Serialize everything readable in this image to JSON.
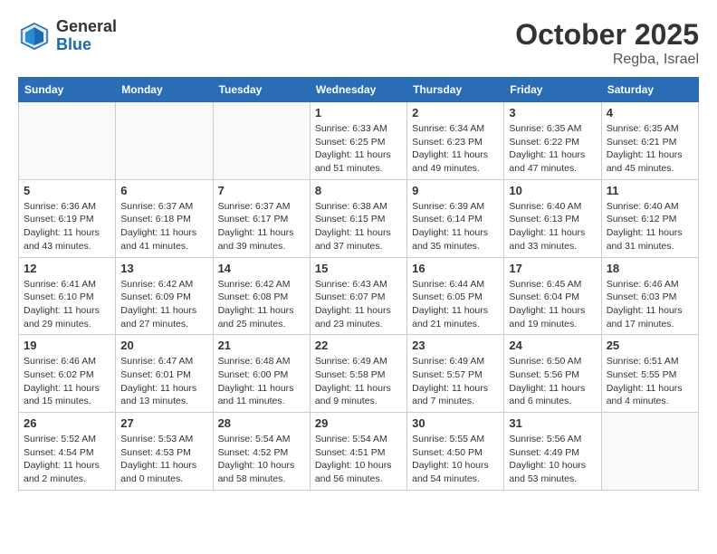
{
  "logo": {
    "general": "General",
    "blue": "Blue"
  },
  "title": "October 2025",
  "location": "Regba, Israel",
  "weekdays": [
    "Sunday",
    "Monday",
    "Tuesday",
    "Wednesday",
    "Thursday",
    "Friday",
    "Saturday"
  ],
  "weeks": [
    [
      {
        "day": "",
        "info": ""
      },
      {
        "day": "",
        "info": ""
      },
      {
        "day": "",
        "info": ""
      },
      {
        "day": "1",
        "info": "Sunrise: 6:33 AM\nSunset: 6:25 PM\nDaylight: 11 hours\nand 51 minutes."
      },
      {
        "day": "2",
        "info": "Sunrise: 6:34 AM\nSunset: 6:23 PM\nDaylight: 11 hours\nand 49 minutes."
      },
      {
        "day": "3",
        "info": "Sunrise: 6:35 AM\nSunset: 6:22 PM\nDaylight: 11 hours\nand 47 minutes."
      },
      {
        "day": "4",
        "info": "Sunrise: 6:35 AM\nSunset: 6:21 PM\nDaylight: 11 hours\nand 45 minutes."
      }
    ],
    [
      {
        "day": "5",
        "info": "Sunrise: 6:36 AM\nSunset: 6:19 PM\nDaylight: 11 hours\nand 43 minutes."
      },
      {
        "day": "6",
        "info": "Sunrise: 6:37 AM\nSunset: 6:18 PM\nDaylight: 11 hours\nand 41 minutes."
      },
      {
        "day": "7",
        "info": "Sunrise: 6:37 AM\nSunset: 6:17 PM\nDaylight: 11 hours\nand 39 minutes."
      },
      {
        "day": "8",
        "info": "Sunrise: 6:38 AM\nSunset: 6:15 PM\nDaylight: 11 hours\nand 37 minutes."
      },
      {
        "day": "9",
        "info": "Sunrise: 6:39 AM\nSunset: 6:14 PM\nDaylight: 11 hours\nand 35 minutes."
      },
      {
        "day": "10",
        "info": "Sunrise: 6:40 AM\nSunset: 6:13 PM\nDaylight: 11 hours\nand 33 minutes."
      },
      {
        "day": "11",
        "info": "Sunrise: 6:40 AM\nSunset: 6:12 PM\nDaylight: 11 hours\nand 31 minutes."
      }
    ],
    [
      {
        "day": "12",
        "info": "Sunrise: 6:41 AM\nSunset: 6:10 PM\nDaylight: 11 hours\nand 29 minutes."
      },
      {
        "day": "13",
        "info": "Sunrise: 6:42 AM\nSunset: 6:09 PM\nDaylight: 11 hours\nand 27 minutes."
      },
      {
        "day": "14",
        "info": "Sunrise: 6:42 AM\nSunset: 6:08 PM\nDaylight: 11 hours\nand 25 minutes."
      },
      {
        "day": "15",
        "info": "Sunrise: 6:43 AM\nSunset: 6:07 PM\nDaylight: 11 hours\nand 23 minutes."
      },
      {
        "day": "16",
        "info": "Sunrise: 6:44 AM\nSunset: 6:05 PM\nDaylight: 11 hours\nand 21 minutes."
      },
      {
        "day": "17",
        "info": "Sunrise: 6:45 AM\nSunset: 6:04 PM\nDaylight: 11 hours\nand 19 minutes."
      },
      {
        "day": "18",
        "info": "Sunrise: 6:46 AM\nSunset: 6:03 PM\nDaylight: 11 hours\nand 17 minutes."
      }
    ],
    [
      {
        "day": "19",
        "info": "Sunrise: 6:46 AM\nSunset: 6:02 PM\nDaylight: 11 hours\nand 15 minutes."
      },
      {
        "day": "20",
        "info": "Sunrise: 6:47 AM\nSunset: 6:01 PM\nDaylight: 11 hours\nand 13 minutes."
      },
      {
        "day": "21",
        "info": "Sunrise: 6:48 AM\nSunset: 6:00 PM\nDaylight: 11 hours\nand 11 minutes."
      },
      {
        "day": "22",
        "info": "Sunrise: 6:49 AM\nSunset: 5:58 PM\nDaylight: 11 hours\nand 9 minutes."
      },
      {
        "day": "23",
        "info": "Sunrise: 6:49 AM\nSunset: 5:57 PM\nDaylight: 11 hours\nand 7 minutes."
      },
      {
        "day": "24",
        "info": "Sunrise: 6:50 AM\nSunset: 5:56 PM\nDaylight: 11 hours\nand 6 minutes."
      },
      {
        "day": "25",
        "info": "Sunrise: 6:51 AM\nSunset: 5:55 PM\nDaylight: 11 hours\nand 4 minutes."
      }
    ],
    [
      {
        "day": "26",
        "info": "Sunrise: 5:52 AM\nSunset: 4:54 PM\nDaylight: 11 hours\nand 2 minutes."
      },
      {
        "day": "27",
        "info": "Sunrise: 5:53 AM\nSunset: 4:53 PM\nDaylight: 11 hours\nand 0 minutes."
      },
      {
        "day": "28",
        "info": "Sunrise: 5:54 AM\nSunset: 4:52 PM\nDaylight: 10 hours\nand 58 minutes."
      },
      {
        "day": "29",
        "info": "Sunrise: 5:54 AM\nSunset: 4:51 PM\nDaylight: 10 hours\nand 56 minutes."
      },
      {
        "day": "30",
        "info": "Sunrise: 5:55 AM\nSunset: 4:50 PM\nDaylight: 10 hours\nand 54 minutes."
      },
      {
        "day": "31",
        "info": "Sunrise: 5:56 AM\nSunset: 4:49 PM\nDaylight: 10 hours\nand 53 minutes."
      },
      {
        "day": "",
        "info": ""
      }
    ]
  ]
}
